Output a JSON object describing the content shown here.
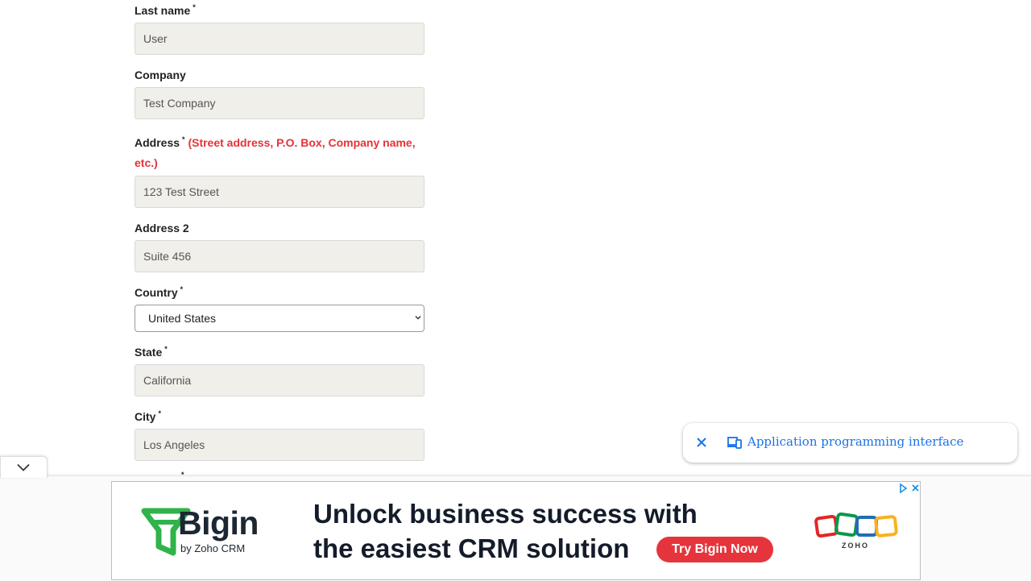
{
  "form": {
    "last_name": {
      "label": "Last name",
      "required_mark": "*",
      "value": "User"
    },
    "company": {
      "label": "Company",
      "value": "Test Company"
    },
    "address": {
      "label": "Address",
      "required_mark": "*",
      "hint": "(Street address, P.O. Box, Company name,",
      "hint_cont": "etc.)",
      "value": "123 Test Street"
    },
    "address2": {
      "label": "Address 2",
      "value": "Suite 456"
    },
    "country": {
      "label": "Country",
      "required_mark": "*",
      "selected": "United States"
    },
    "state": {
      "label": "State",
      "required_mark": "*",
      "value": "California"
    },
    "city": {
      "label": "City",
      "required_mark": "*",
      "value": "Los Angeles"
    },
    "next_required_mark": "*"
  },
  "popup": {
    "text": "Application programming interface",
    "icon": "devices-icon",
    "close_icon": "close-icon"
  },
  "ad": {
    "brand": "Bigin",
    "brand_sub": "by Zoho CRM",
    "headline_1": "Unlock business success with",
    "headline_2": "the easiest CRM solution",
    "cta": "Try Bigin Now",
    "zoho": "ZOHO",
    "colors": {
      "brand_green": "#2fb34a",
      "cta_red": "#e5343b",
      "zoho_red": "#e42527",
      "zoho_green": "#089949",
      "zoho_blue": "#226db4",
      "zoho_yellow": "#f9b21d"
    }
  }
}
